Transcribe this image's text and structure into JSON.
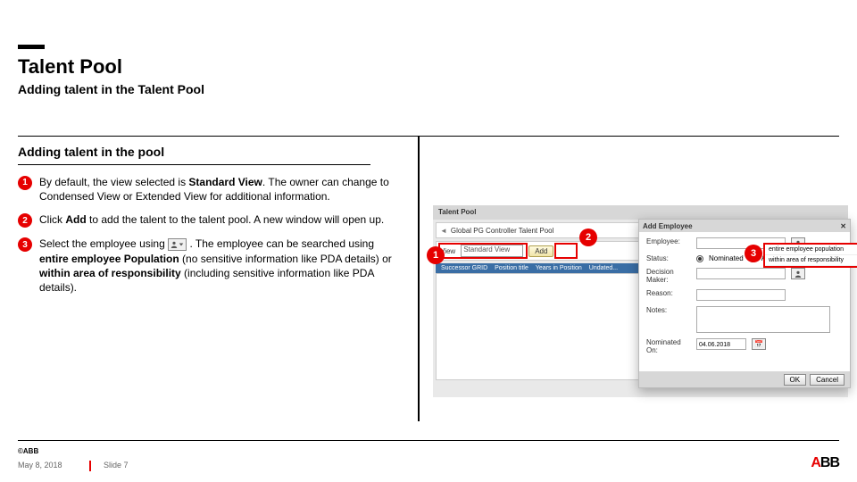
{
  "header": {
    "title": "Talent Pool",
    "subtitle": "Adding talent in the Talent Pool"
  },
  "section": {
    "heading": "Adding talent in the pool",
    "steps": [
      {
        "num": "1",
        "pre": "By default, the view selected is ",
        "b1": "Standard View",
        "mid": ". The owner can change to Condensed View or Extended View for additional information."
      },
      {
        "num": "2",
        "pre": "Click ",
        "b1": "Add",
        "mid": " to add the talent to the talent pool. A new window will open up."
      },
      {
        "num": "3",
        "pre": "Select the employee using ",
        "icon": true,
        "mid1": ". The employee can be searched using ",
        "b1": "entire employee Population",
        "mid2": " (no sensitive information like PDA details) or ",
        "b2": "within area of responsibility",
        "mid3": " (including sensitive information like PDA details)."
      }
    ]
  },
  "screenshot": {
    "panel_title": "Talent Pool",
    "toolbar_text": "Global PG Controller Talent Pool",
    "view_label": "View",
    "view_value": "Standard View",
    "add_label": "Add",
    "tabs": [
      "Successor GRID",
      "Position title",
      "Years in Position",
      "Undated..."
    ],
    "dialog": {
      "title": "Add Employee",
      "fields": {
        "employee": "Employee:",
        "status": "Status:",
        "decision_maker": "Decision Maker:",
        "reason": "Reason:",
        "notes": "Notes:",
        "nominated_on": "Nominated On:",
        "date": "04.06.2018"
      },
      "status_nominated": "Nominated",
      "status_approved": "Approved",
      "dropdown_opt1": "entire employee population",
      "dropdown_opt2": "within area of responsibility",
      "ok": "OK",
      "cancel": "Cancel"
    }
  },
  "callouts": {
    "c1": "1",
    "c2": "2",
    "c3": "3"
  },
  "footer": {
    "copyright": "©ABB",
    "date": "May 8, 2018",
    "slide": "Slide 7",
    "logo_a": "A",
    "logo_bb": "BB"
  }
}
